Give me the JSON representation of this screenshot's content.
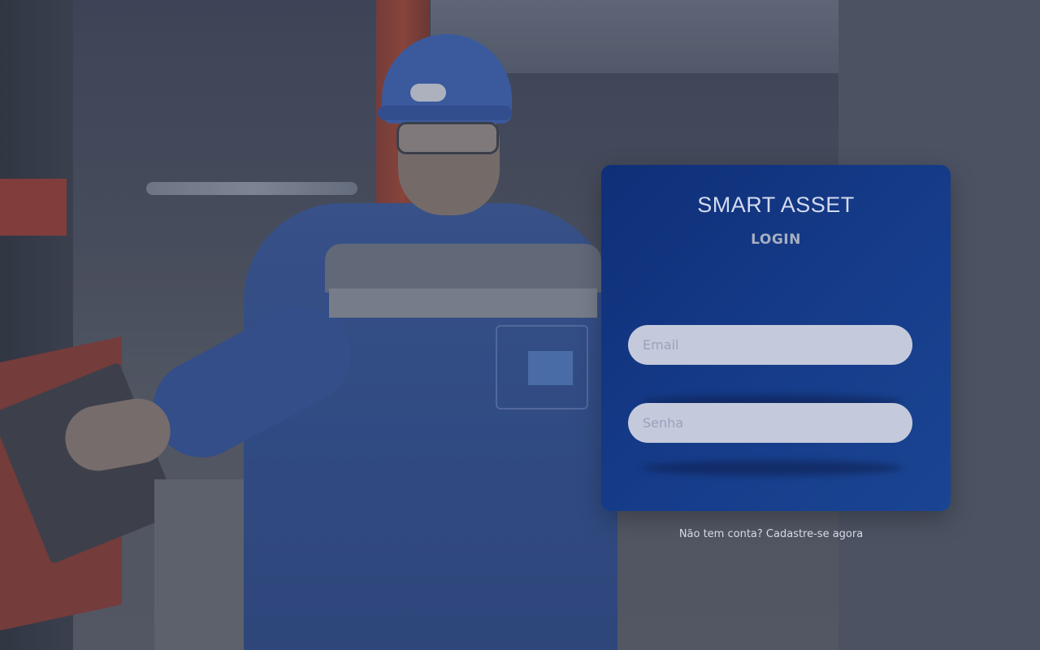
{
  "app": {
    "title": "SMART ASSET"
  },
  "login": {
    "heading": "LOGIN",
    "email_placeholder": "Email",
    "password_placeholder": "Senha",
    "signup_text": "Não tem conta? Cadastre-se agora"
  },
  "colors": {
    "background": "#4c5262",
    "card": "#163c8a",
    "field": "#c4cadc"
  },
  "icons": {
    "background_photo": "worker-photo"
  }
}
